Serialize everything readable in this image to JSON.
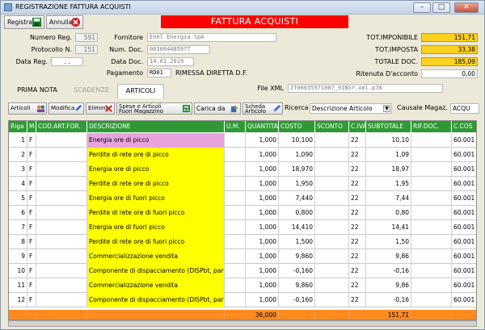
{
  "window": {
    "title": "REGISTRAZIONE FATTURA ACQUISTI",
    "minimize": "–",
    "maximize": "□",
    "close": "✕"
  },
  "toolbar": {
    "registra_label": "Registra",
    "annulla_label": "Annulla"
  },
  "banner": {
    "title": "FATTURA ACQUISTI"
  },
  "header": {
    "numero_reg_label": "Numero Reg.",
    "numero_reg": "591",
    "protocollo_label": "Protocollo N.",
    "protocollo": "151",
    "data_reg_label": "Data Reg.",
    "data_reg": ". .",
    "fornitore_label": "Fornitore",
    "fornitore": "Enel Energia SpA",
    "num_doc_label": "Num. Doc.",
    "num_doc": "003004485977",
    "data_doc_label": "Data Doc.",
    "data_doc": "14.01.2019",
    "pagamento_label": "Pagamento",
    "pagamento_code": "RD01",
    "pagamento_desc": "RIMESSA DIRETTA D.F.",
    "tot_imponibile_label": "TOT.IMPONIBILE",
    "tot_imponibile": "151,71",
    "tot_imposta_label": "TOT.IMPOSTA",
    "tot_imposta": "33,38",
    "totale_doc_label": "TOTALE DOC.",
    "totale_doc": "185,09",
    "ritenuta_label": "Ritenuta D'acconto",
    "ritenuta": "0,00",
    "file_xml_label": "File XML",
    "file_xml": "IT06655971007_91NSY.xml.p7m"
  },
  "tabs": {
    "prima_nota": "PRIMA NOTA",
    "scadenze": "SCADENZE",
    "articoli": "ARTICOLI"
  },
  "subtoolbar": {
    "articoli": "Articoli",
    "modifica": "Modifica",
    "elimina": "Elimina",
    "spese_line1": "Spese e Articoli",
    "spese_line2": "Fuori Magazzino",
    "carica_da": "Carica da",
    "scheda_line1": "Scheda",
    "scheda_line2": "Articolo",
    "ricerca_label": "Ricerca",
    "ricerca_value": "Descrizione Articolo",
    "causale_label": "Causale Magaz.",
    "causale_value": "ACQU"
  },
  "grid": {
    "columns": [
      "Riga",
      "M",
      "COD.ART.FOR.",
      "DESCRIZIONE",
      "U.M.",
      "QUANTITA'",
      "COSTO",
      "SCONTO",
      "C.IVA",
      "SUBTOTALE",
      "RIF.DOC.",
      "C.COS"
    ],
    "rows": [
      {
        "riga": "1",
        "m": "F",
        "cod": "",
        "desc": "Energia ore di picco",
        "um": "",
        "qta": "1,000",
        "costo": "10,100",
        "sconto": "",
        "civa": "22",
        "sub": "10,10",
        "rif": "",
        "ccos": "60.001"
      },
      {
        "riga": "2",
        "m": "F",
        "cod": "",
        "desc": "Perdite di rete ore di picco",
        "um": "",
        "qta": "1,000",
        "costo": "1,090",
        "sconto": "",
        "civa": "22",
        "sub": "1,09",
        "rif": "",
        "ccos": "60.001"
      },
      {
        "riga": "3",
        "m": "F",
        "cod": "",
        "desc": "Energia ore di picco",
        "um": "",
        "qta": "1,000",
        "costo": "18,970",
        "sconto": "",
        "civa": "22",
        "sub": "18,97",
        "rif": "",
        "ccos": "60.001"
      },
      {
        "riga": "4",
        "m": "F",
        "cod": "",
        "desc": "Perdite di rete ore di picco",
        "um": "",
        "qta": "1,000",
        "costo": "1,950",
        "sconto": "",
        "civa": "22",
        "sub": "1,95",
        "rif": "",
        "ccos": "60.001"
      },
      {
        "riga": "5",
        "m": "F",
        "cod": "",
        "desc": "Energia ore di fuori picco",
        "um": "",
        "qta": "1,000",
        "costo": "7,440",
        "sconto": "",
        "civa": "22",
        "sub": "7,44",
        "rif": "",
        "ccos": "60.001"
      },
      {
        "riga": "6",
        "m": "F",
        "cod": "",
        "desc": "Perdite di rete ore di fuori picco",
        "um": "",
        "qta": "1,000",
        "costo": "0,800",
        "sconto": "",
        "civa": "22",
        "sub": "0,80",
        "rif": "",
        "ccos": "60.001"
      },
      {
        "riga": "7",
        "m": "F",
        "cod": "",
        "desc": "Energia ore di fuori picco",
        "um": "",
        "qta": "1,000",
        "costo": "14,410",
        "sconto": "",
        "civa": "22",
        "sub": "14,41",
        "rif": "",
        "ccos": "60.001"
      },
      {
        "riga": "8",
        "m": "F",
        "cod": "",
        "desc": "Perdite di rete ore di fuori picco",
        "um": "",
        "qta": "1,000",
        "costo": "1,500",
        "sconto": "",
        "civa": "22",
        "sub": "1,50",
        "rif": "",
        "ccos": "60.001"
      },
      {
        "riga": "9",
        "m": "F",
        "cod": "",
        "desc": "Commercializzazione vendita",
        "um": "",
        "qta": "1,000",
        "costo": "9,860",
        "sconto": "",
        "civa": "22",
        "sub": "9,86",
        "rif": "",
        "ccos": "60.001"
      },
      {
        "riga": "10",
        "m": "F",
        "cod": "",
        "desc": "Componente di dispacciamento (DISPbt, parte fi...",
        "um": "",
        "qta": "1,000",
        "costo": "-0,160",
        "sconto": "",
        "civa": "22",
        "sub": "-0,16",
        "rif": "",
        "ccos": "60.001"
      },
      {
        "riga": "11",
        "m": "F",
        "cod": "",
        "desc": "Commercializzazione vendita",
        "um": "",
        "qta": "1,000",
        "costo": "9,860",
        "sconto": "",
        "civa": "22",
        "sub": "9,86",
        "rif": "",
        "ccos": "60.001"
      },
      {
        "riga": "12",
        "m": "F",
        "cod": "",
        "desc": "Componente di dispacciamento (DISPbt, parte fi...",
        "um": "",
        "qta": "1,000",
        "costo": "-0,160",
        "sconto": "",
        "civa": "22",
        "sub": "-0,16",
        "rif": "",
        "ccos": "60.001"
      }
    ],
    "footer": {
      "qta": "36,000",
      "sub": "151,71"
    }
  },
  "colors": {
    "banner": "#ff0000",
    "grid_header": "#2f9a35",
    "totals": "#ffd21f",
    "footer": "#ff8a1e",
    "desc_highlight": "#ffff00",
    "desc_selected": "#e8a3dc"
  },
  "icons": {
    "registra": "floppy-save-icon",
    "annulla": "cancel-circle-icon"
  }
}
